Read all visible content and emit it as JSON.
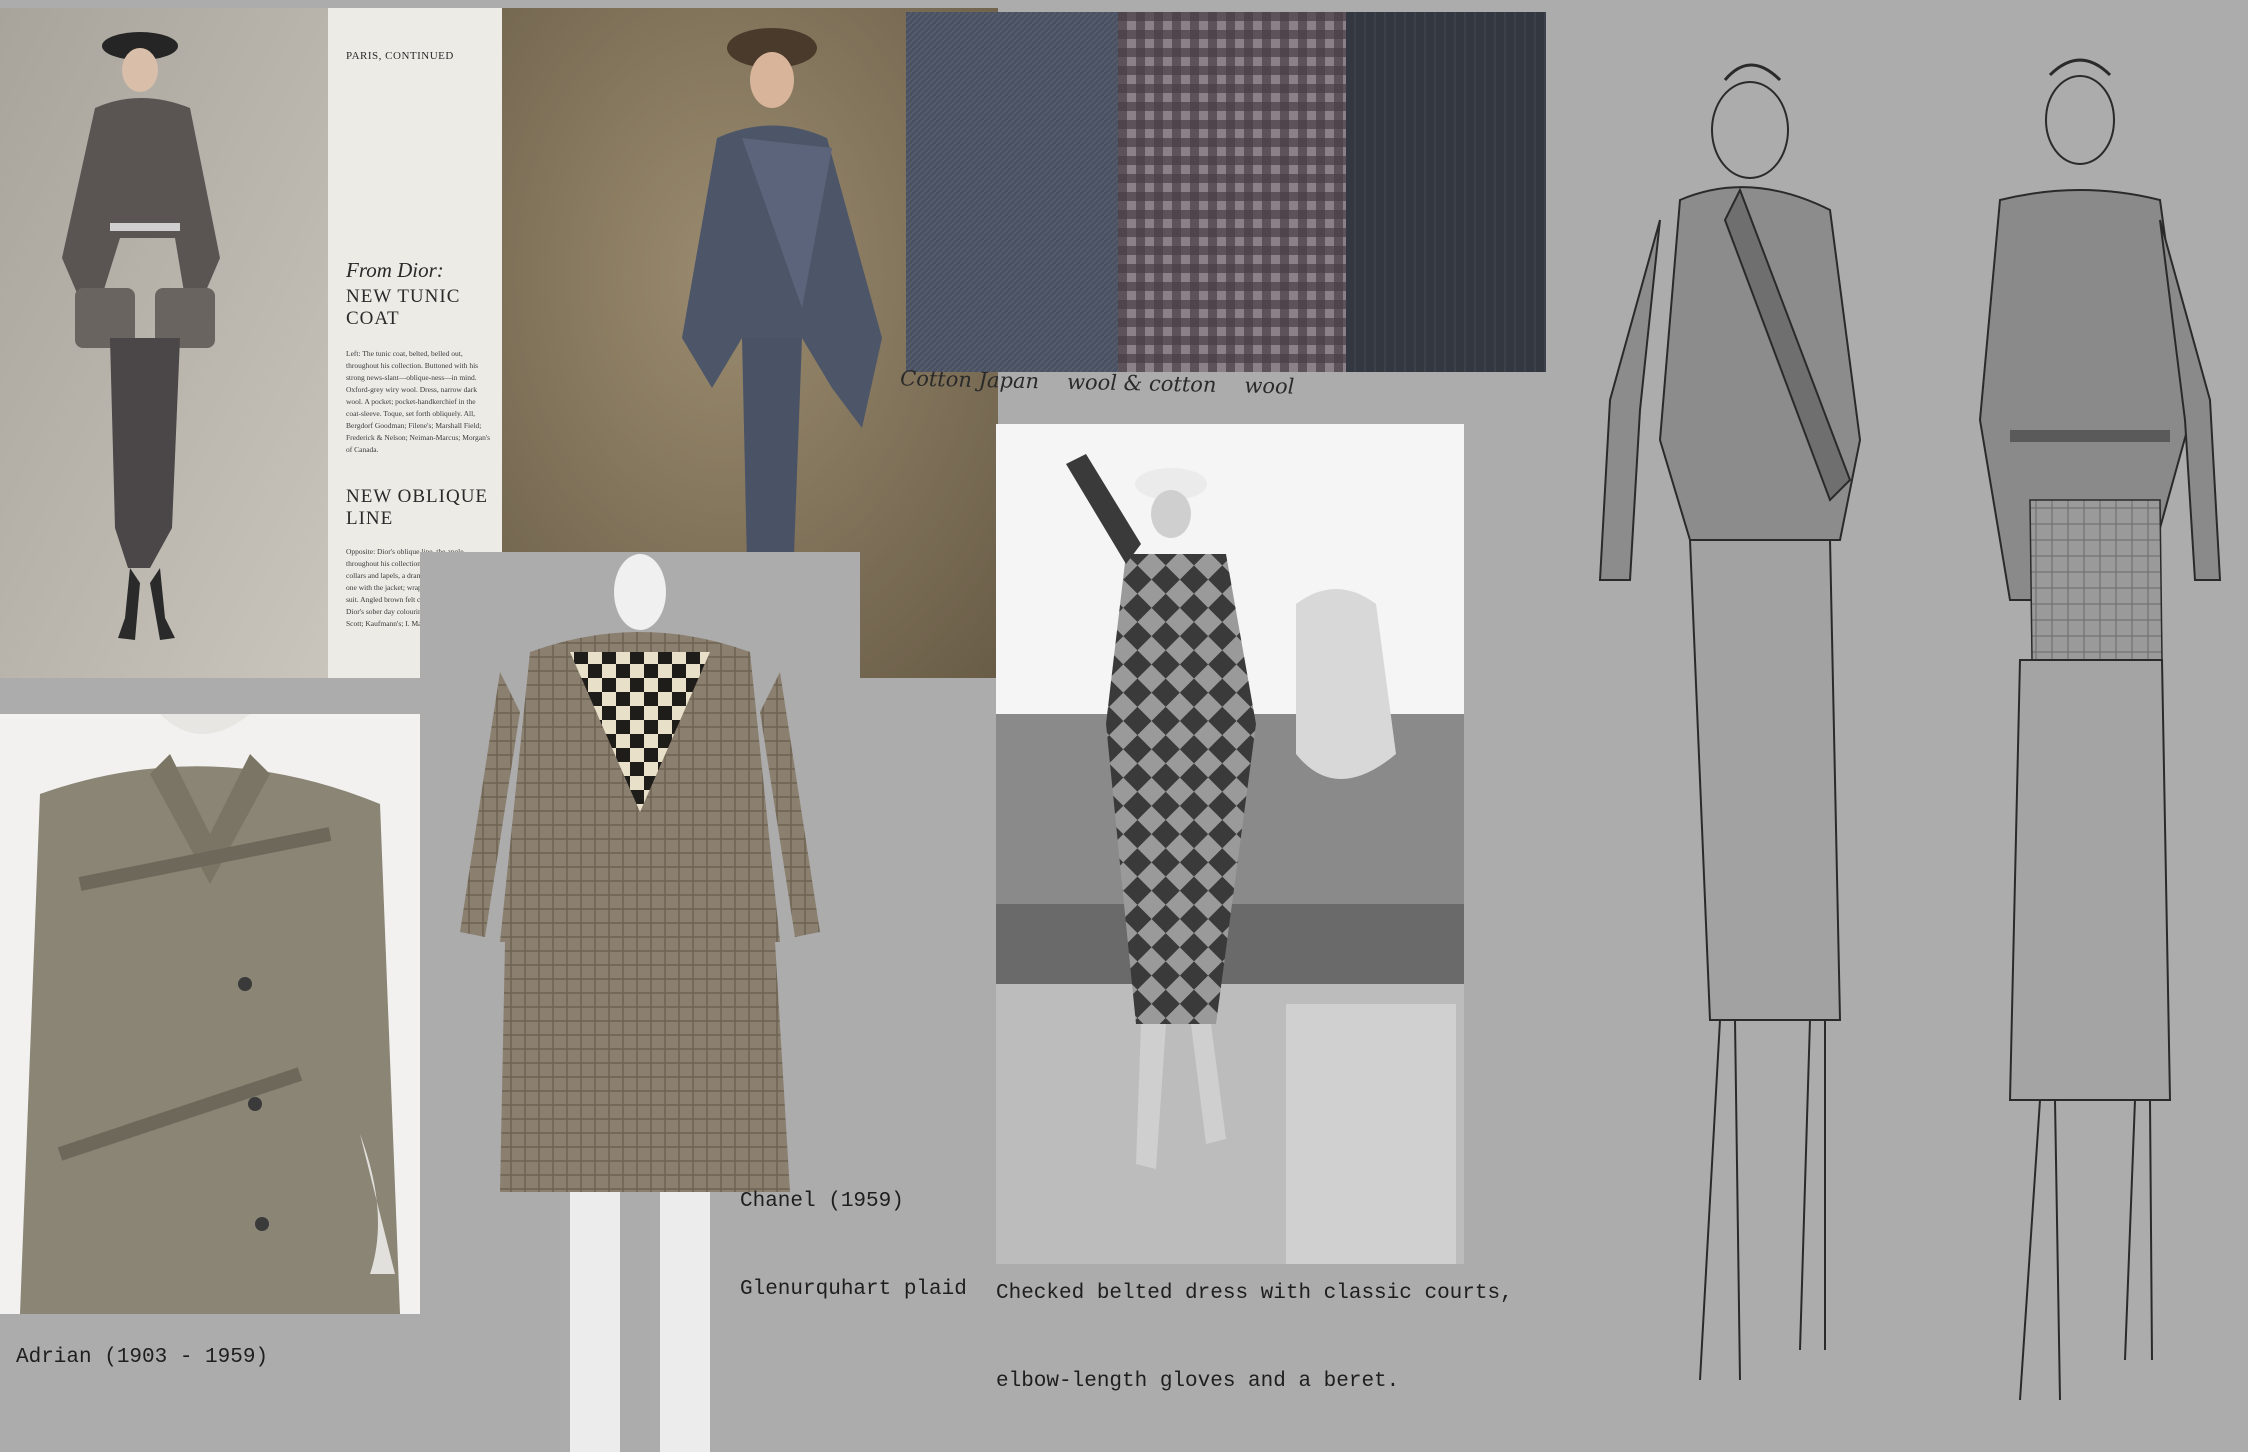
{
  "magazine": {
    "continued": "PARIS, CONTINUED",
    "from_dior": "From Dior:",
    "headline1": "NEW TUNIC COAT",
    "body1": "Left: The tunic coat, belted, belled out, throughout his collection. Buttoned with his strong news-slant—oblique-ness—in mind. Oxford-grey wiry wool. Dress, narrow dark wool. A pocket; pocket-handkerchief in the coat-sleeve. Toque, set forth obliquely. All, Bergdorf Goodman; Filene's; Marshall Field; Frederick & Nelson; Neiman-Marcus; Morgan's of Canada.",
    "headline2": "NEW OBLIQUE LINE",
    "body2": "Opposite: Dior's oblique line, the angle throughout his collection. Here, instead of collars and lapels, a dramatic aside: a scarf cut one with the jacket; wrapped over. Grey flannel suit. Angled brown felt casserole hat. Typical of Dior's sober day colouring. All, Carson Pirie Scott; Kaufmann's; I. Magnin; Henri Bendel."
  },
  "swatches": {
    "notes": [
      "Cotton Japan",
      "wool & cotton",
      "wool"
    ],
    "colors": [
      "#4a5262",
      "#5c5158",
      "#33373f"
    ]
  },
  "captions": {
    "adrian": "Adrian (1903 - 1959)",
    "chanel_title": "Chanel (1959)",
    "chanel_fabric": "Glenurquhart plaid",
    "checked_line1": "Checked belted dress with classic courts,",
    "checked_line2": "elbow-length gloves and a beret."
  }
}
